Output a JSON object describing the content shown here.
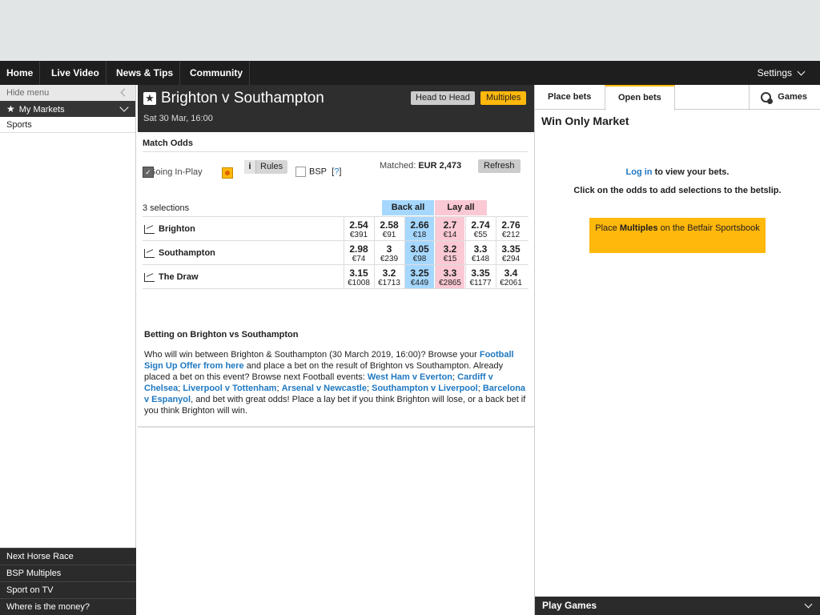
{
  "nav": {
    "items": [
      "Home",
      "Live Video",
      "News & Tips",
      "Community"
    ],
    "settings": "Settings"
  },
  "left_menu": {
    "hide_menu": "Hide menu",
    "my_markets": "My Markets",
    "sports": "Sports",
    "bottom_links": [
      "Next Horse Race",
      "BSP Multiples",
      "Sport on TV",
      "Where is the money?"
    ]
  },
  "event": {
    "title": "Brighton v Southampton",
    "date": "Sat 30 Mar, 16:00",
    "head_to_head": "Head to Head",
    "multiples": "Multiples"
  },
  "market": {
    "title": "Match Odds",
    "going_in_play": "Going In-Play",
    "rules": "Rules",
    "bsp": "BSP",
    "bsp_help": "?",
    "matched_label": "Matched:",
    "matched_value": "EUR 2,473",
    "refresh": "Refresh",
    "selections": "3 selections",
    "back_all": "Back all",
    "lay_all": "Lay all",
    "runners": [
      {
        "name": "Brighton",
        "odds": [
          {
            "price": "2.54",
            "size": "€391"
          },
          {
            "price": "2.58",
            "size": "€91"
          },
          {
            "price": "2.66",
            "size": "€18"
          },
          {
            "price": "2.7",
            "size": "€14"
          },
          {
            "price": "2.74",
            "size": "€55"
          },
          {
            "price": "2.76",
            "size": "€212"
          }
        ]
      },
      {
        "name": "Southampton",
        "odds": [
          {
            "price": "2.98",
            "size": "€74"
          },
          {
            "price": "3",
            "size": "€239"
          },
          {
            "price": "3.05",
            "size": "€98"
          },
          {
            "price": "3.2",
            "size": "€15"
          },
          {
            "price": "3.3",
            "size": "€148"
          },
          {
            "price": "3.35",
            "size": "€294"
          }
        ]
      },
      {
        "name": "The Draw",
        "odds": [
          {
            "price": "3.15",
            "size": "€1008"
          },
          {
            "price": "3.2",
            "size": "€1713"
          },
          {
            "price": "3.25",
            "size": "€449"
          },
          {
            "price": "3.3",
            "size": "€2865"
          },
          {
            "price": "3.35",
            "size": "€1177"
          },
          {
            "price": "3.4",
            "size": "€2061"
          }
        ]
      }
    ]
  },
  "info": {
    "heading": "Betting on Brighton vs Southampton",
    "t1": "Who will win between Brighton & Southampton (30 March 2019, 16:00)? Browse your ",
    "link1": "Football Sign Up Offer from here",
    "t2": " and place a bet on the result of Brighton vs Southampton. Already placed a bet on this event? Browse next Football events: ",
    "link2": "West Ham v Everton",
    "sep": "; ",
    "link3": "Cardiff v Chelsea",
    "link4": "Liverpool v Tottenham",
    "link5": "Arsenal v Newcastle",
    "link6": "Southampton v Liverpool",
    "link7": "Barcelona v Espanyol",
    "t3": ", and bet with great odds! Place a lay bet if you think Brighton will lose, or a back bet if you think Brighton will win."
  },
  "betslip": {
    "tab_place": "Place bets",
    "tab_open": "Open bets",
    "tab_games": "Games",
    "win_only": "Win Only Market",
    "login": "Log in",
    "login_rest": " to view your bets.",
    "click_msg": "Click on the odds to add selections to the betslip.",
    "place": "Place ",
    "multiples": "Multiples",
    "place_rest": " on the Betfair Sportsbook",
    "play_games": "Play Games"
  }
}
